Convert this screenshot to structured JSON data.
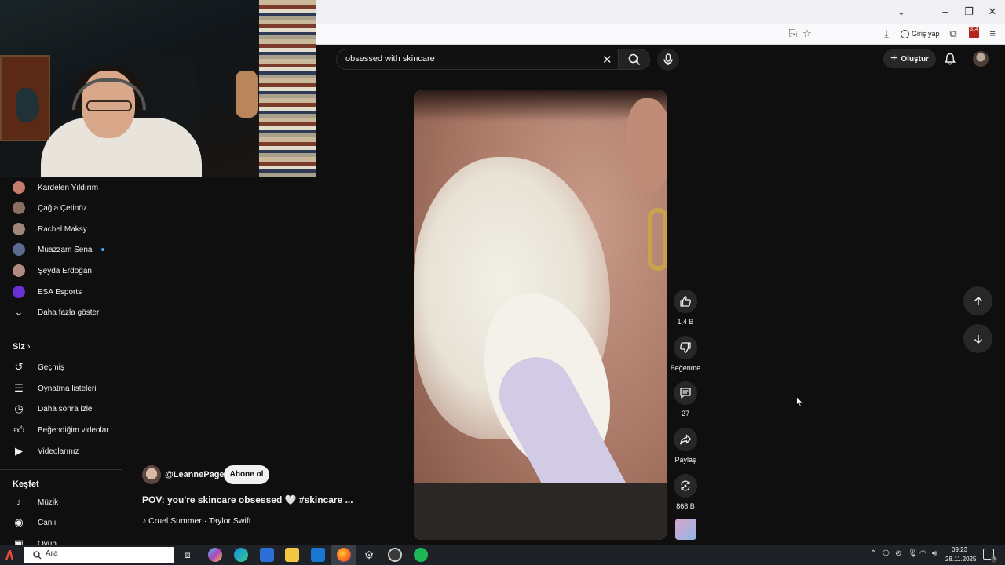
{
  "browser": {
    "sign_in_label": "Giriş yap",
    "extension_badge": "314"
  },
  "search": {
    "query": "obsessed with skincare"
  },
  "header": {
    "create_label": "Oluştur"
  },
  "sidebar": {
    "subscriptions": [
      {
        "label": "Kardelen Yıldırım",
        "color": "#c77b6b"
      },
      {
        "label": "Çağla Çetinöz",
        "color": "#8a6f62"
      },
      {
        "label": "Rachel Maksy",
        "color": "#a0847a"
      },
      {
        "label": "Muazzam Sena",
        "color": "#5b6b8f"
      },
      {
        "label": "Şeyda Erdoğan",
        "color": "#b08b7f"
      },
      {
        "label": "ESA Esports",
        "color": "#6b2fd6"
      }
    ],
    "show_more_label": "Daha fazla göster",
    "you_heading": "Siz",
    "you_items": [
      {
        "label": "Geçmiş",
        "icon": "history-icon"
      },
      {
        "label": "Oynatma listeleri",
        "icon": "playlist-icon"
      },
      {
        "label": "Daha sonra izle",
        "icon": "watch-later-icon"
      },
      {
        "label": "Beğendiğim videolar",
        "icon": "liked-icon"
      },
      {
        "label": "Videolarınız",
        "icon": "your-videos-icon"
      }
    ],
    "explore_heading": "Keşfet",
    "explore_items": [
      {
        "label": "Müzik",
        "icon": "music-icon"
      },
      {
        "label": "Canlı",
        "icon": "live-icon"
      },
      {
        "label": "Oyun",
        "icon": "gaming-icon"
      }
    ]
  },
  "actions": {
    "like_count": "1,4 B",
    "dislike_label": "Beğenme",
    "comment_count": "27",
    "share_label": "Paylaş",
    "remix_count": "868 B"
  },
  "video": {
    "channel": "@LeannePage",
    "subscribe_label": "Abone ol",
    "title": "POV: you're skincare obsessed 🤍 #skincare ...",
    "music": "Cruel Summer · Taylor Swift"
  },
  "taskbar": {
    "search_placeholder": "Ara",
    "time": "09:23",
    "date": "28.11.2025",
    "notification_count": "3"
  }
}
